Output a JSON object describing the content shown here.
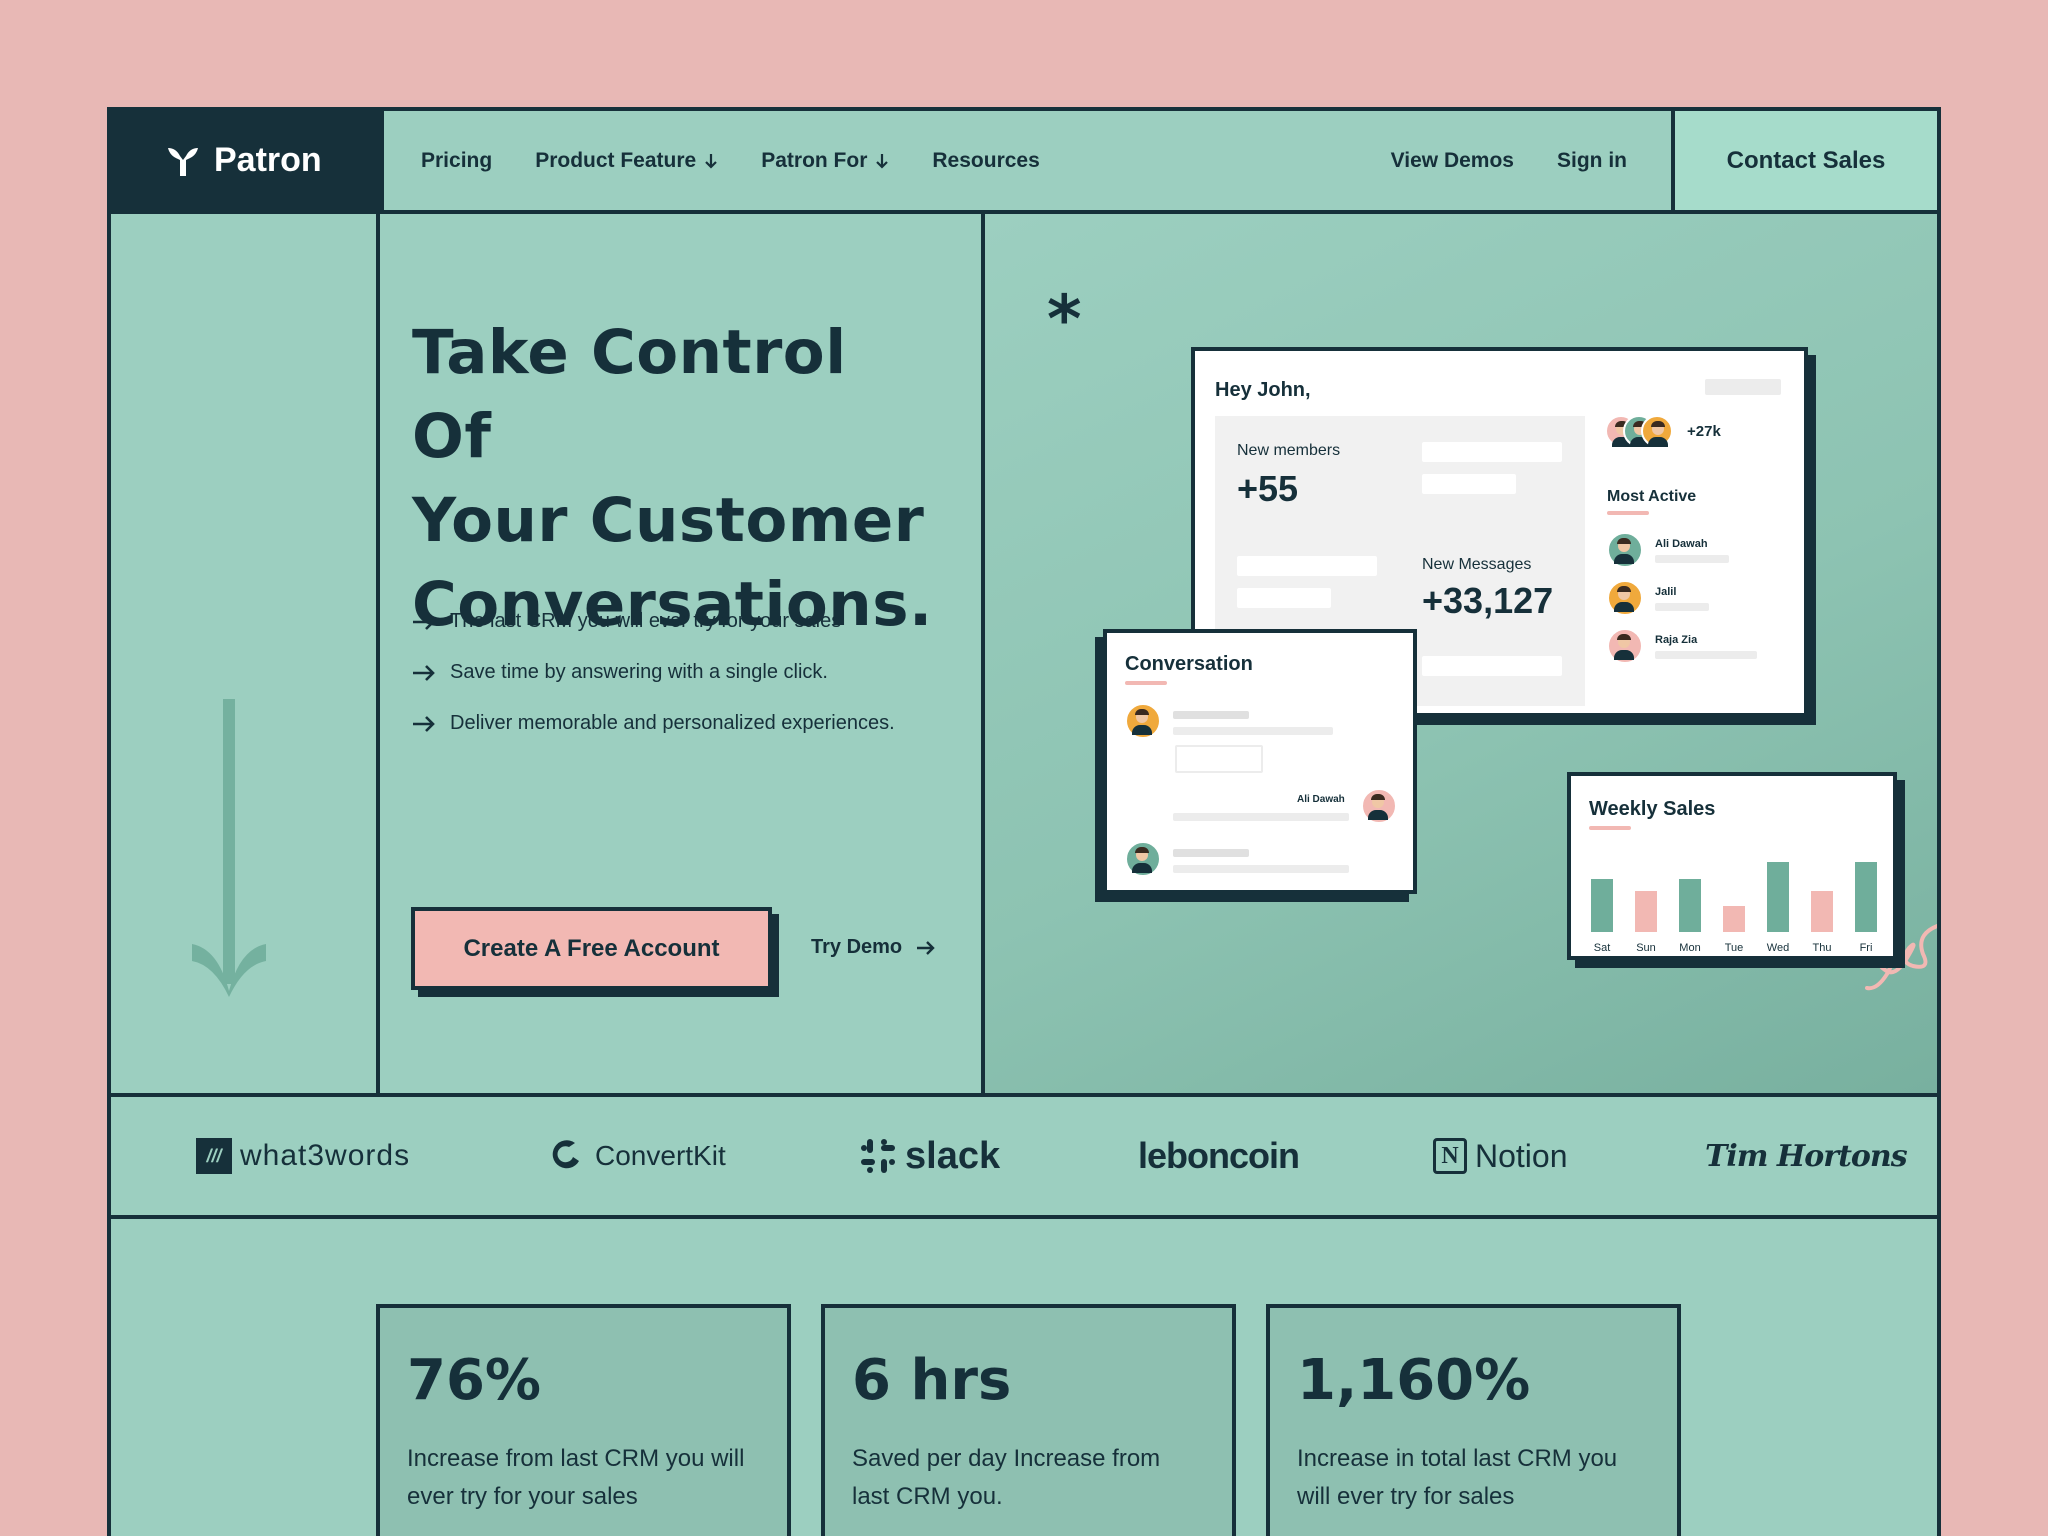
{
  "brand": {
    "name": "Patron"
  },
  "nav": {
    "links": [
      {
        "label": "Pricing",
        "has_dropdown": false
      },
      {
        "label": "Product Feature",
        "has_dropdown": true
      },
      {
        "label": "Patron For",
        "has_dropdown": true
      },
      {
        "label": "Resources",
        "has_dropdown": false
      }
    ],
    "view_demos": "View Demos",
    "sign_in": "Sign in",
    "contact_sales": "Contact Sales"
  },
  "hero": {
    "title_lines": [
      "Take Control Of",
      "Your Customer",
      "Conversations."
    ],
    "bullets": [
      "The last CRM you will ever try for your sales",
      "Save time by answering with a single click.",
      "Deliver memorable and personalized experiences."
    ],
    "cta_label": "Create A Free Account",
    "try_demo_label": "Try Demo"
  },
  "dashboard": {
    "greeting": "Hey John,",
    "new_members_label": "New members",
    "new_members_value": "+55",
    "new_messages_label": "New Messages",
    "new_messages_value": "+33,127",
    "avatar_count": "+27k",
    "most_active_title": "Most Active",
    "most_active": [
      "Ali Dawah",
      "Jalil",
      "Raja Zia"
    ]
  },
  "conversation": {
    "title": "Conversation",
    "reply_name": "Ali Dawah"
  },
  "weekly_sales": {
    "title": "Weekly Sales",
    "days": [
      "Sat",
      "Sun",
      "Mon",
      "Tue",
      "Wed",
      "Thu",
      "Fri"
    ],
    "values": [
      62,
      48,
      62,
      30,
      82,
      48,
      82
    ],
    "colors": [
      "#6fae9b",
      "#f2b8b3",
      "#6fae9b",
      "#f2b8b3",
      "#6fae9b",
      "#f2b8b3",
      "#6fae9b"
    ]
  },
  "logos": [
    "what3words",
    "ConvertKit",
    "slack",
    "leboncoin",
    "Notion",
    "Tim Hortons"
  ],
  "stats": [
    {
      "value": "76%",
      "text": "Increase from last CRM you will ever try for your sales"
    },
    {
      "value": "6 hrs",
      "text": "Saved per day Increase from last CRM you."
    },
    {
      "value": "1,160%",
      "text": "Increase in total last CRM you will ever try for sales"
    }
  ],
  "colors": {
    "page_bg": "#e8b8b5",
    "mint": "#9ccfc0",
    "dark": "#16303a",
    "pink": "#f2b8b3",
    "bar_green": "#6fae9b"
  }
}
